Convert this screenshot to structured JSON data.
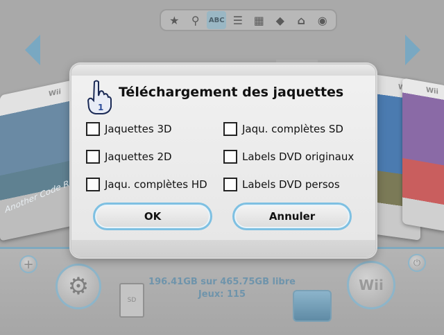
{
  "toolbar": {
    "abc_label": "ABC"
  },
  "status": {
    "storage": "196.41GB sur 465.75GB libre",
    "games_count": "Jeux: 115"
  },
  "covers": {
    "left_title": "Another Code R",
    "wii_badge": "Wii"
  },
  "bottom": {
    "wii_label": "Wii",
    "sd_label": "SD"
  },
  "dialog": {
    "title": "Téléchargement des jaquettes",
    "options": [
      {
        "label": "Jaquettes 3D",
        "checked": false
      },
      {
        "label": "Jaqu. complètes SD",
        "checked": false
      },
      {
        "label": "Jaquettes 2D",
        "checked": false
      },
      {
        "label": "Labels DVD originaux",
        "checked": false
      },
      {
        "label": "Jaqu. complètes HD",
        "checked": false
      },
      {
        "label": "Labels DVD persos",
        "checked": false
      }
    ],
    "ok_label": "OK",
    "cancel_label": "Annuler"
  },
  "colors": {
    "accent": "#7ec0e2",
    "background_dim": "#a9a9a9"
  }
}
